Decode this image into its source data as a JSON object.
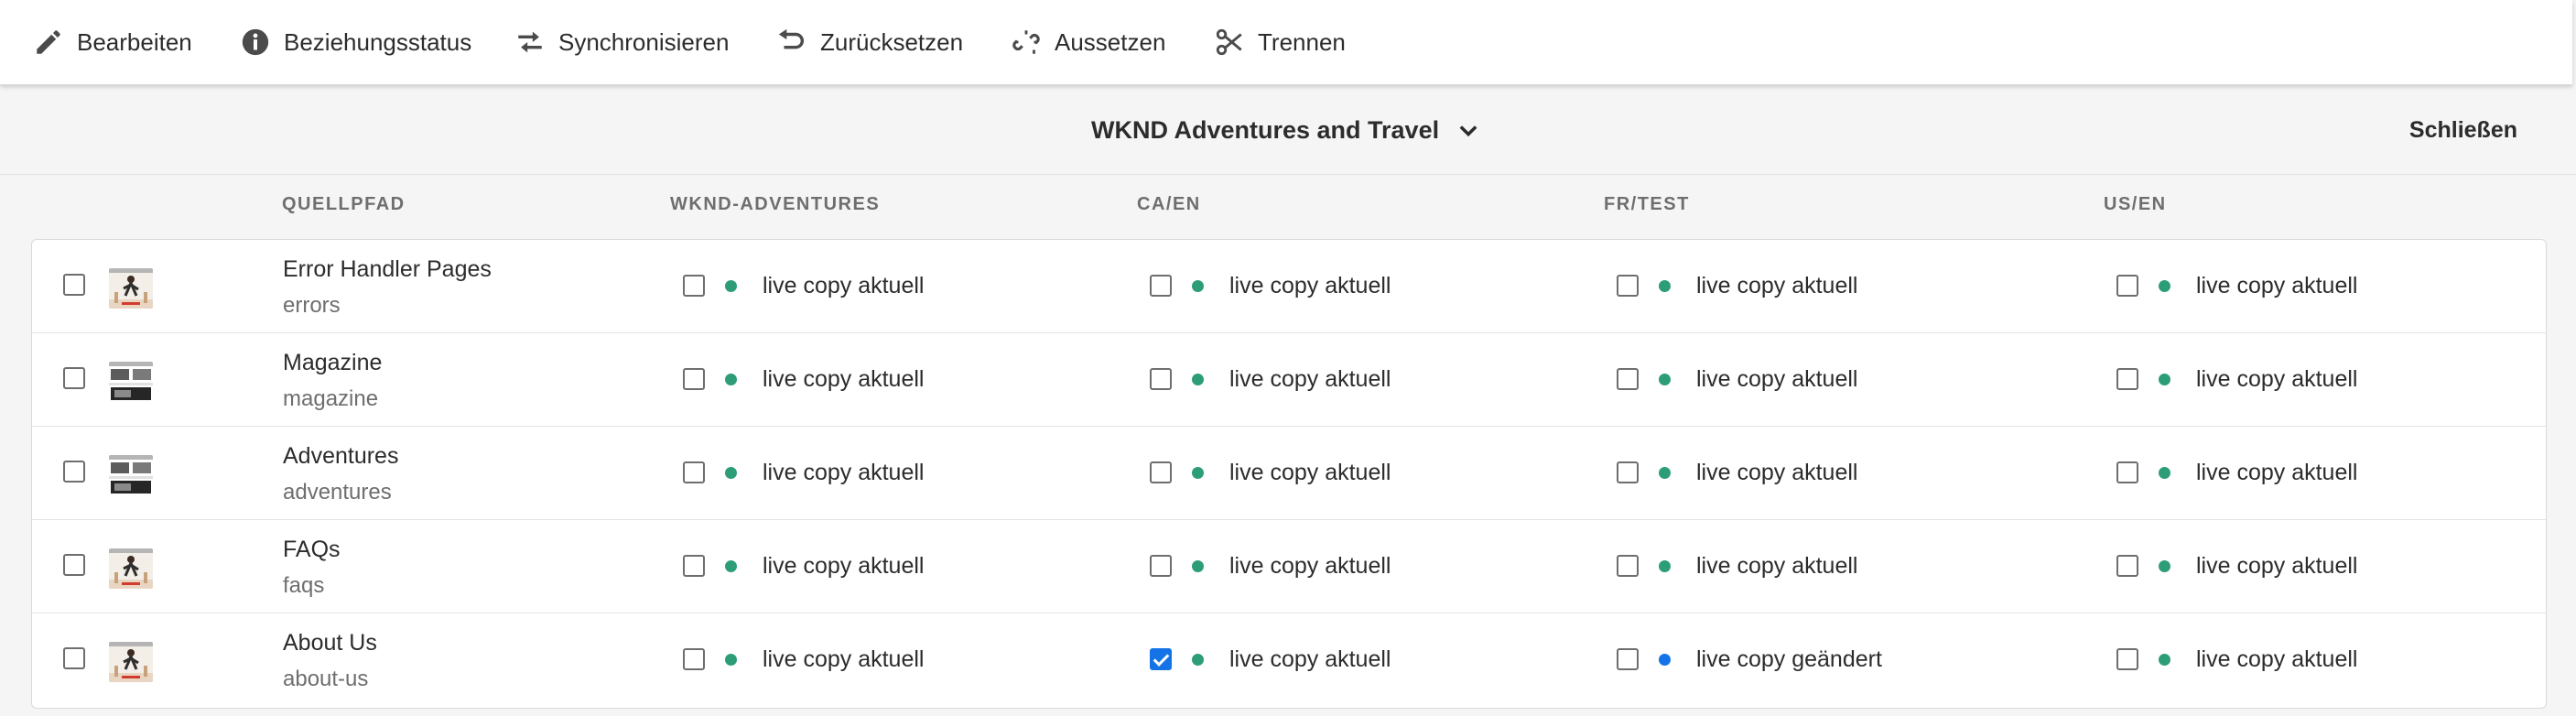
{
  "colors": {
    "status_current": "#2d9d78",
    "status_changed": "#1473e6",
    "checkbox_checked": "#1473e6"
  },
  "toolbar": [
    {
      "id": "edit",
      "label": "Bearbeiten",
      "icon": "pencil-icon"
    },
    {
      "id": "relationship-status",
      "label": "Beziehungsstatus",
      "icon": "info-icon"
    },
    {
      "id": "synchronize",
      "label": "Synchronisieren",
      "icon": "sync-arrows-icon"
    },
    {
      "id": "reset",
      "label": "Zurücksetzen",
      "icon": "undo-icon"
    },
    {
      "id": "suspend",
      "label": "Aussetzen",
      "icon": "broken-link-icon"
    },
    {
      "id": "detach",
      "label": "Trennen",
      "icon": "scissors-icon"
    }
  ],
  "header": {
    "title": "WKND Adventures and Travel",
    "dropdown_icon": "chevron-down-icon",
    "close_label": "Schließen"
  },
  "columns": [
    "QUELLPFAD",
    "WKND-ADVENTURES",
    "CA/EN",
    "FR/TEST",
    "US/EN"
  ],
  "rows": [
    {
      "title": "Error Handler Pages",
      "path": "errors",
      "thumbnail": "page-thumbnail-person",
      "selected": false,
      "statuses": [
        {
          "label": "live copy aktuell",
          "state": "current",
          "checked": false
        },
        {
          "label": "live copy aktuell",
          "state": "current",
          "checked": false
        },
        {
          "label": "live copy aktuell",
          "state": "current",
          "checked": false
        },
        {
          "label": "live copy aktuell",
          "state": "current",
          "checked": false
        }
      ]
    },
    {
      "title": "Magazine",
      "path": "magazine",
      "thumbnail": "page-thumbnail-layout",
      "selected": false,
      "statuses": [
        {
          "label": "live copy aktuell",
          "state": "current",
          "checked": false
        },
        {
          "label": "live copy aktuell",
          "state": "current",
          "checked": false
        },
        {
          "label": "live copy aktuell",
          "state": "current",
          "checked": false
        },
        {
          "label": "live copy aktuell",
          "state": "current",
          "checked": false
        }
      ]
    },
    {
      "title": "Adventures",
      "path": "adventures",
      "thumbnail": "page-thumbnail-layout",
      "selected": false,
      "statuses": [
        {
          "label": "live copy aktuell",
          "state": "current",
          "checked": false
        },
        {
          "label": "live copy aktuell",
          "state": "current",
          "checked": false
        },
        {
          "label": "live copy aktuell",
          "state": "current",
          "checked": false
        },
        {
          "label": "live copy aktuell",
          "state": "current",
          "checked": false
        }
      ]
    },
    {
      "title": "FAQs",
      "path": "faqs",
      "thumbnail": "page-thumbnail-person",
      "selected": false,
      "statuses": [
        {
          "label": "live copy aktuell",
          "state": "current",
          "checked": false
        },
        {
          "label": "live copy aktuell",
          "state": "current",
          "checked": false
        },
        {
          "label": "live copy aktuell",
          "state": "current",
          "checked": false
        },
        {
          "label": "live copy aktuell",
          "state": "current",
          "checked": false
        }
      ]
    },
    {
      "title": "About Us",
      "path": "about-us",
      "thumbnail": "page-thumbnail-person",
      "selected": false,
      "statuses": [
        {
          "label": "live copy aktuell",
          "state": "current",
          "checked": false
        },
        {
          "label": "live copy aktuell",
          "state": "current",
          "checked": true
        },
        {
          "label": "live copy geändert",
          "state": "changed",
          "checked": false
        },
        {
          "label": "live copy aktuell",
          "state": "current",
          "checked": false
        }
      ]
    }
  ]
}
